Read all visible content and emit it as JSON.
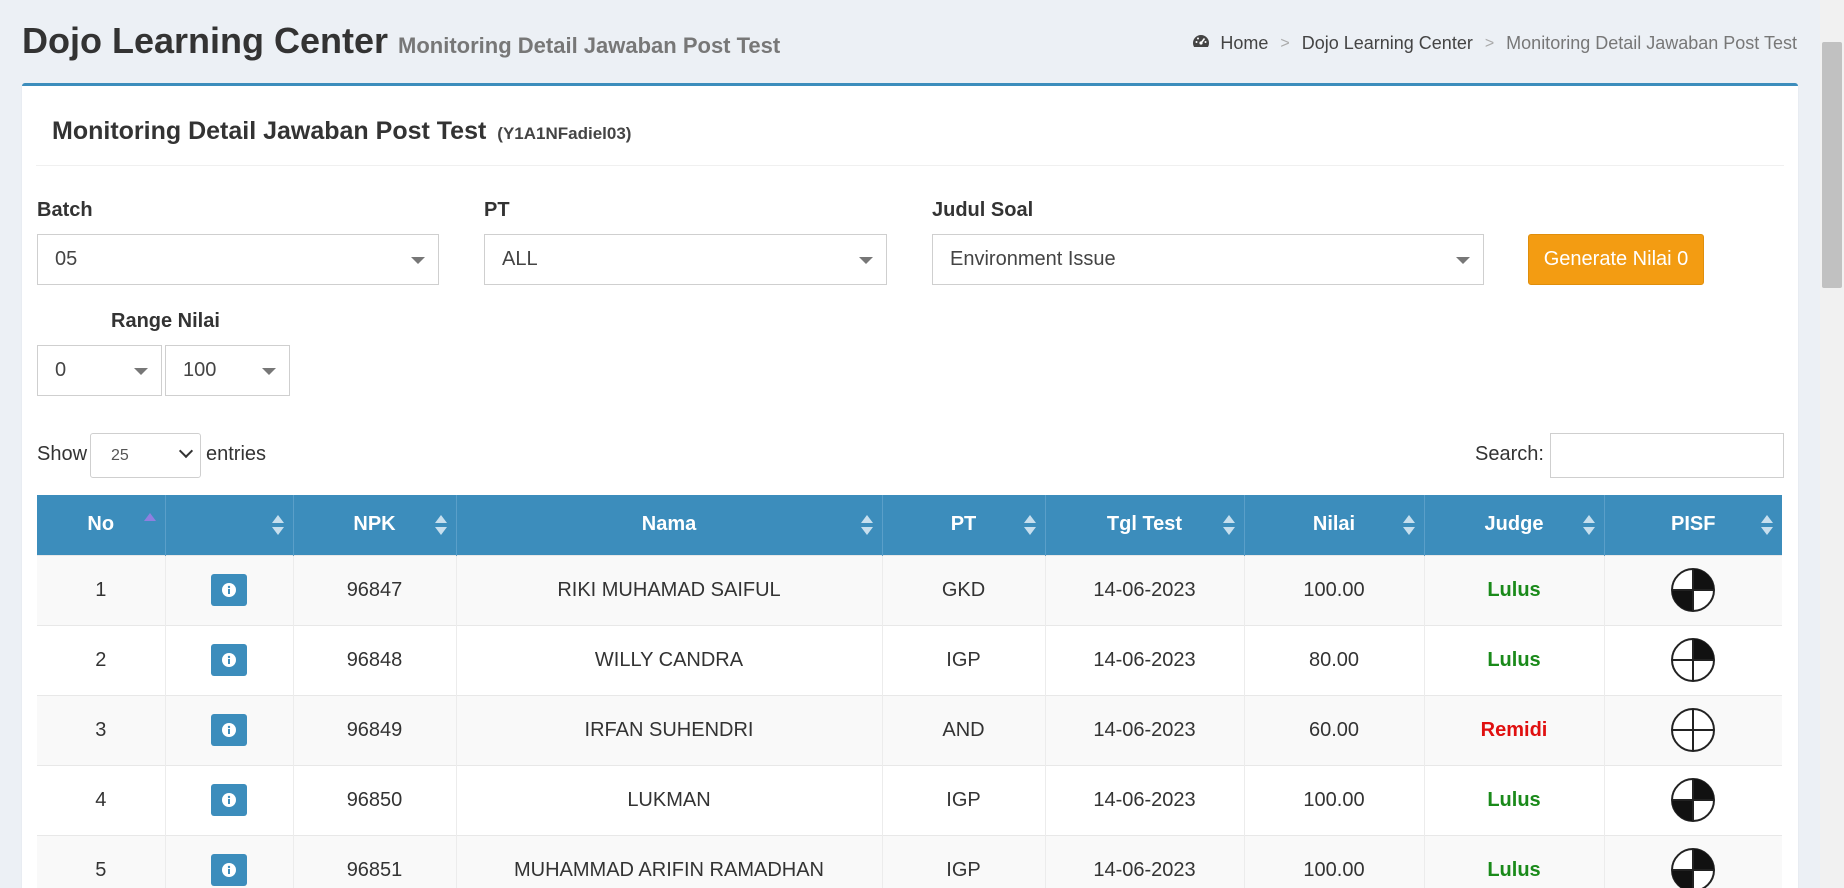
{
  "header": {
    "title": "Dojo Learning Center",
    "subtitle": "Monitoring Detail Jawaban Post Test",
    "breadcrumb": [
      "Home",
      "Dojo Learning Center",
      "Monitoring Detail Jawaban Post Test"
    ]
  },
  "box": {
    "title": "Monitoring Detail Jawaban Post Test",
    "code": "(Y1A1NFadiel03)"
  },
  "filters": {
    "batch_label": "Batch",
    "batch_value": "05",
    "pt_label": "PT",
    "pt_value": "ALL",
    "judul_label": "Judul Soal",
    "judul_value": "Environment Issue",
    "generate_label": "Generate Nilai 0",
    "range_label": "Range Nilai",
    "range_min": "0",
    "range_max": "100"
  },
  "datatable": {
    "show_label": "Show",
    "length_value": "25",
    "entries_label": "entries",
    "search_label": "Search:"
  },
  "table": {
    "columns": [
      "No",
      "",
      "NPK",
      "Nama",
      "PT",
      "Tgl Test",
      "Nilai",
      "Judge",
      "PISF"
    ],
    "rows": [
      {
        "no": "1",
        "npk": "96847",
        "nama": "RIKI MUHAMAD SAIFUL",
        "pt": "GKD",
        "tgl": "14-06-2023",
        "nilai": "100.00",
        "judge": "Lulus",
        "pass": true,
        "pisf_quadrants": 2
      },
      {
        "no": "2",
        "npk": "96848",
        "nama": "WILLY CANDRA",
        "pt": "IGP",
        "tgl": "14-06-2023",
        "nilai": "80.00",
        "judge": "Lulus",
        "pass": true,
        "pisf_quadrants": 1
      },
      {
        "no": "3",
        "npk": "96849",
        "nama": "IRFAN SUHENDRI",
        "pt": "AND",
        "tgl": "14-06-2023",
        "nilai": "60.00",
        "judge": "Remidi",
        "pass": false,
        "pisf_quadrants": 0
      },
      {
        "no": "4",
        "npk": "96850",
        "nama": "LUKMAN",
        "pt": "IGP",
        "tgl": "14-06-2023",
        "nilai": "100.00",
        "judge": "Lulus",
        "pass": true,
        "pisf_quadrants": 2
      },
      {
        "no": "5",
        "npk": "96851",
        "nama": "MUHAMMAD ARIFIN RAMADHAN",
        "pt": "IGP",
        "tgl": "14-06-2023",
        "nilai": "100.00",
        "judge": "Lulus",
        "pass": true,
        "pisf_quadrants": 2
      }
    ]
  },
  "colors": {
    "primary": "#3c8dbc",
    "warning": "#f39c12",
    "pass": "#1a8a1a",
    "fail": "#e01010"
  },
  "icons": {
    "breadcrumb_home": "dashboard-icon",
    "row_action": "info-icon",
    "pisf": "pisf-circle-icon"
  }
}
